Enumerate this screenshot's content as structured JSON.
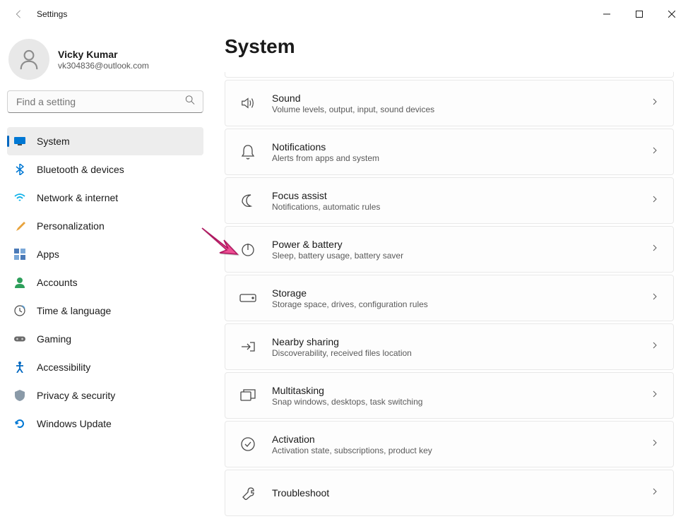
{
  "titlebar": {
    "title": "Settings"
  },
  "profile": {
    "name": "Vicky Kumar",
    "email": "vk304836@outlook.com"
  },
  "search": {
    "placeholder": "Find a setting"
  },
  "nav": [
    {
      "id": "system",
      "label": "System",
      "active": true
    },
    {
      "id": "bluetooth",
      "label": "Bluetooth & devices"
    },
    {
      "id": "network",
      "label": "Network & internet"
    },
    {
      "id": "personalization",
      "label": "Personalization"
    },
    {
      "id": "apps",
      "label": "Apps"
    },
    {
      "id": "accounts",
      "label": "Accounts"
    },
    {
      "id": "time",
      "label": "Time & language"
    },
    {
      "id": "gaming",
      "label": "Gaming"
    },
    {
      "id": "accessibility",
      "label": "Accessibility"
    },
    {
      "id": "privacy",
      "label": "Privacy & security"
    },
    {
      "id": "update",
      "label": "Windows Update"
    }
  ],
  "page": {
    "title": "System"
  },
  "cards": [
    {
      "id": "sound",
      "title": "Sound",
      "desc": "Volume levels, output, input, sound devices"
    },
    {
      "id": "notifications",
      "title": "Notifications",
      "desc": "Alerts from apps and system"
    },
    {
      "id": "focus",
      "title": "Focus assist",
      "desc": "Notifications, automatic rules"
    },
    {
      "id": "power",
      "title": "Power & battery",
      "desc": "Sleep, battery usage, battery saver"
    },
    {
      "id": "storage",
      "title": "Storage",
      "desc": "Storage space, drives, configuration rules"
    },
    {
      "id": "nearby",
      "title": "Nearby sharing",
      "desc": "Discoverability, received files location"
    },
    {
      "id": "multitasking",
      "title": "Multitasking",
      "desc": "Snap windows, desktops, task switching"
    },
    {
      "id": "activation",
      "title": "Activation",
      "desc": "Activation state, subscriptions, product key"
    },
    {
      "id": "troubleshoot",
      "title": "Troubleshoot",
      "desc": ""
    }
  ],
  "annotation": {
    "target": "power",
    "color": "#e91e63"
  }
}
